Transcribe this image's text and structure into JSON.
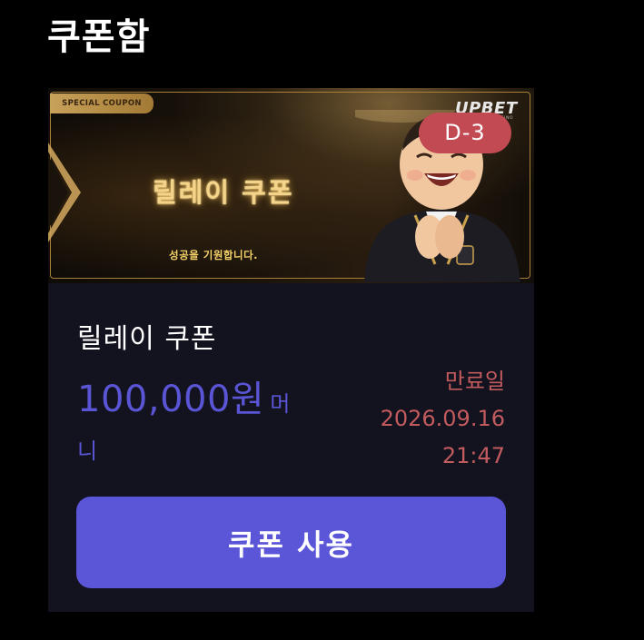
{
  "header": {
    "title": "쿠폰함"
  },
  "coupon": {
    "banner": {
      "tag": "SPECIAL COUPON",
      "title": "릴레이 쿠폰",
      "subtitle": "성공을 기원합니다.",
      "brand": "UPBET",
      "brand_sub": "SPORTS & CASINO"
    },
    "dday": "D-3",
    "name": "릴레이 쿠폰",
    "amount": "100,000원",
    "amount_unit_part1": "머",
    "amount_unit_part2": "니",
    "expiry_label": "만료일",
    "expiry_date": "2026.09.16",
    "expiry_time": "21:47",
    "use_button": "쿠폰 사용"
  },
  "colors": {
    "background": "#000000",
    "card": "#13121f",
    "accent": "#5b55d8",
    "expiry": "#c25b5e",
    "badge": "#c24a52",
    "gold": "#f3d48a"
  }
}
